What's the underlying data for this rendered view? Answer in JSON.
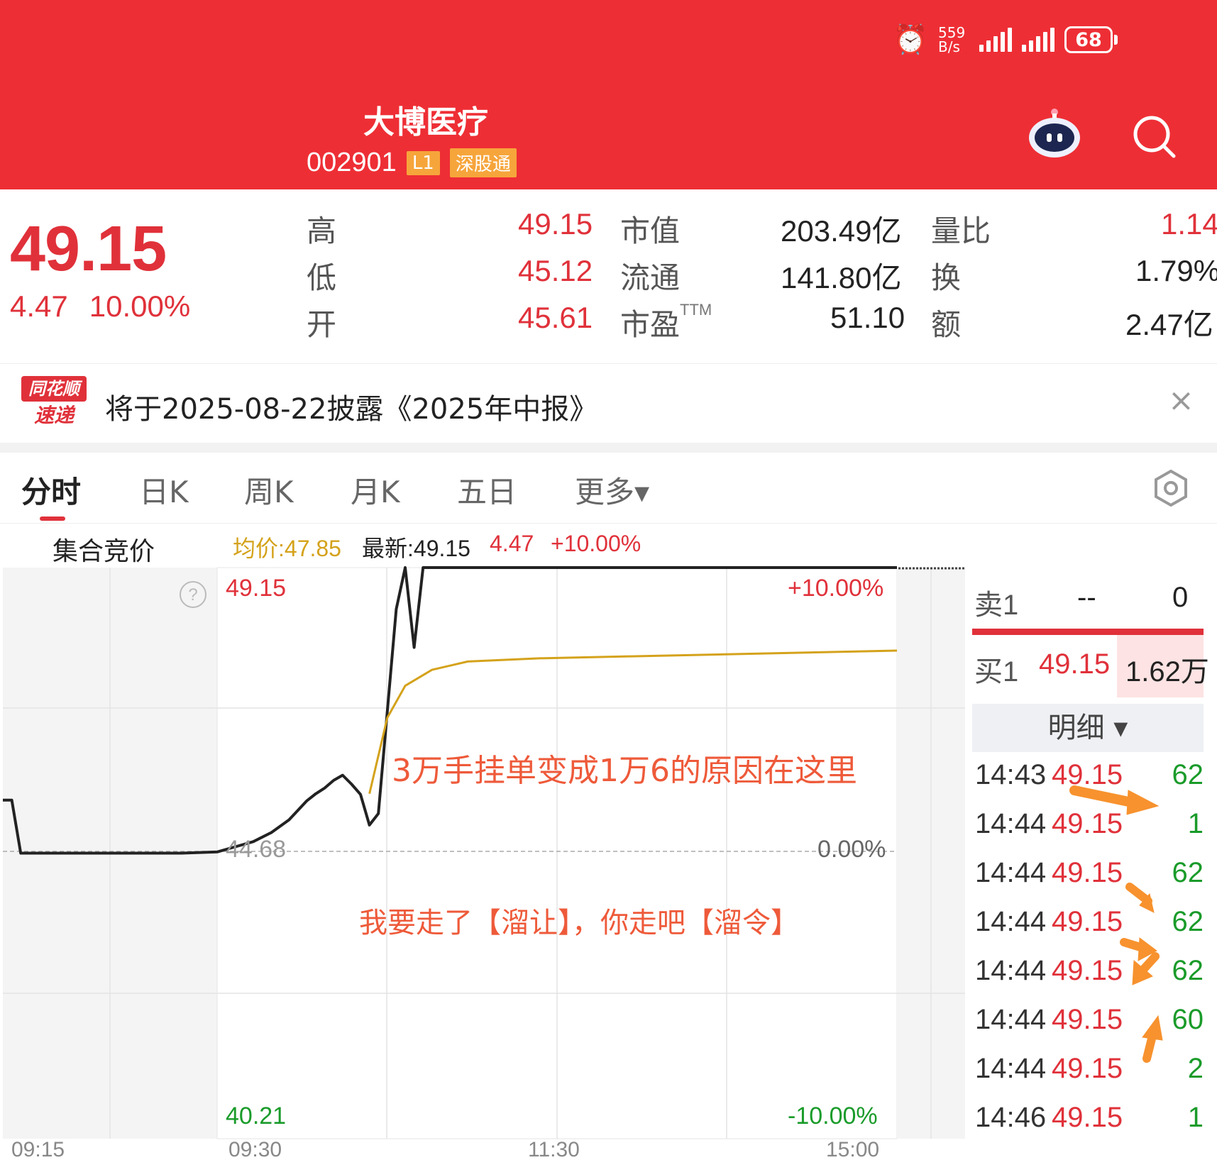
{
  "status_bar": {
    "speed_value": "559",
    "speed_unit": "B/s",
    "battery": "68"
  },
  "header": {
    "title": "大博医疗",
    "code": "002901",
    "tag_level": "L1",
    "tag_connect": "深股通"
  },
  "quote": {
    "price": "49.15",
    "change": "4.47",
    "change_pct": "10.00%",
    "stats": [
      {
        "label": "高",
        "value": "49.15"
      },
      {
        "label": "低",
        "value": "45.12"
      },
      {
        "label": "开",
        "value": "45.61"
      },
      {
        "label": "市值",
        "value": "203.49亿"
      },
      {
        "label": "流通",
        "value": "141.80亿"
      },
      {
        "label": "市盈",
        "sup": "TTM",
        "value": "51.10"
      },
      {
        "label": "量比",
        "value": "1.14"
      },
      {
        "label": "换",
        "value": "1.79%"
      },
      {
        "label": "额",
        "value": "2.47亿"
      }
    ]
  },
  "news": {
    "logo_top": "同花顺",
    "logo_bottom": "速递",
    "text": "将于2025-08-22披露《2025年中报》",
    "close": "×"
  },
  "tabs": [
    {
      "label": "分时"
    },
    {
      "label": "日K"
    },
    {
      "label": "周K"
    },
    {
      "label": "月K"
    },
    {
      "label": "五日"
    },
    {
      "label": "更多▾"
    }
  ],
  "chart_info": {
    "auction_label": "集合竞价",
    "avg_price": "均价:47.85",
    "latest": "最新:49.15",
    "change": "4.47",
    "change_pct": "+10.00%"
  },
  "chart_data": {
    "type": "line",
    "y_labels": {
      "top": "49.15",
      "mid": "44.68",
      "bottom": "40.21"
    },
    "pct_labels": {
      "top": "+10.00%",
      "mid": "0.00%",
      "bottom": "-10.00%"
    },
    "x_ticks": [
      "09:15",
      "09:30",
      "11:30",
      "15:00"
    ],
    "ylim": [
      40.21,
      49.15
    ],
    "series": [
      {
        "name": "价格",
        "color": "#222222",
        "points": [
          [
            0,
            45.51
          ],
          [
            0.01,
            45.51
          ],
          [
            0.02,
            44.68
          ],
          [
            0.12,
            44.68
          ],
          [
            0.2,
            44.68
          ],
          [
            0.24,
            44.7
          ],
          [
            0.26,
            44.78
          ],
          [
            0.28,
            44.86
          ],
          [
            0.3,
            45.0
          ],
          [
            0.32,
            45.2
          ],
          [
            0.34,
            45.5
          ],
          [
            0.35,
            45.61
          ],
          [
            0.36,
            45.7
          ],
          [
            0.37,
            45.82
          ],
          [
            0.38,
            45.9
          ],
          [
            0.39,
            45.76
          ],
          [
            0.4,
            45.6
          ],
          [
            0.41,
            45.12
          ],
          [
            0.42,
            45.3
          ],
          [
            0.44,
            48.5
          ],
          [
            0.45,
            49.15
          ],
          [
            0.46,
            47.9
          ],
          [
            0.47,
            49.15
          ],
          [
            1.0,
            49.15
          ]
        ]
      },
      {
        "name": "均价",
        "color": "#d4a21b",
        "points": [
          [
            0.41,
            45.61
          ],
          [
            0.43,
            46.8
          ],
          [
            0.45,
            47.3
          ],
          [
            0.48,
            47.55
          ],
          [
            0.52,
            47.68
          ],
          [
            0.6,
            47.73
          ],
          [
            0.7,
            47.76
          ],
          [
            0.8,
            47.79
          ],
          [
            0.9,
            47.82
          ],
          [
            1.0,
            47.85
          ]
        ]
      }
    ]
  },
  "annotations": {
    "note1": "3万手挂单变成1万6的原因在这里",
    "note2": "我要走了【溜让】，你走吧【溜令】"
  },
  "orderbook": {
    "sell1": {
      "label": "卖1",
      "price": "--",
      "volume": "0"
    },
    "buy1": {
      "label": "买1",
      "price": "49.15",
      "volume": "1.62万"
    },
    "detail_label": "明细 ▾",
    "trades": [
      {
        "time": "14:43",
        "price": "49.15",
        "volume": "62"
      },
      {
        "time": "14:44",
        "price": "49.15",
        "volume": "1"
      },
      {
        "time": "14:44",
        "price": "49.15",
        "volume": "62"
      },
      {
        "time": "14:44",
        "price": "49.15",
        "volume": "62"
      },
      {
        "time": "14:44",
        "price": "49.15",
        "volume": "62"
      },
      {
        "time": "14:44",
        "price": "49.15",
        "volume": "60"
      },
      {
        "time": "14:44",
        "price": "49.15",
        "volume": "2"
      },
      {
        "time": "14:46",
        "price": "49.15",
        "volume": "1"
      }
    ]
  },
  "colors": {
    "header": "#ee2e35",
    "up": "#e0313a",
    "down": "#1a9b2a",
    "avg": "#d4a21b",
    "annotation": "#ee5a3a",
    "arrow": "#f7922e"
  }
}
